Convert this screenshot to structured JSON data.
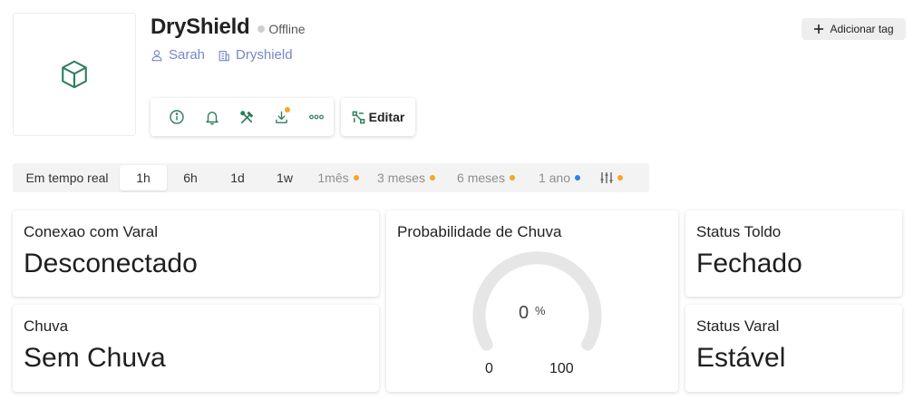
{
  "device": {
    "name": "DryShield",
    "status": "Offline",
    "owner": "Sarah",
    "group": "Dryshield"
  },
  "actions": {
    "edit_label": "Editar",
    "add_tag_label": "Adicionar tag"
  },
  "toolbar": {
    "icons": [
      "info-icon",
      "bell-icon",
      "tools-icon",
      "download-icon",
      "more-icon"
    ]
  },
  "timeframe": {
    "items": [
      {
        "label": "Em tempo real"
      },
      {
        "label": "1h",
        "active": true
      },
      {
        "label": "6h"
      },
      {
        "label": "1d"
      },
      {
        "label": "1w"
      },
      {
        "label": "1mês",
        "dot": "#f5a623"
      },
      {
        "label": "3 meses",
        "dot": "#f5a623"
      },
      {
        "label": "6 meses",
        "dot": "#f5a623"
      },
      {
        "label": "1 ano",
        "dot": "#2f80ed"
      }
    ],
    "filter_dot": "#f5a623"
  },
  "widgets": {
    "conexao": {
      "title": "Conexao com Varal",
      "value": "Desconectado"
    },
    "chuva": {
      "title": "Chuva",
      "value": "Sem Chuva"
    },
    "probabilidade": {
      "title": "Probabilidade de Chuva",
      "value": "0",
      "unit": "%",
      "min": "0",
      "max": "100",
      "level": 0
    },
    "toldo": {
      "title": "Status Toldo",
      "value": "Fechado"
    },
    "varal": {
      "title": "Status Varal",
      "value": "Estável"
    }
  },
  "colors": {
    "accent": "#2e7d5b",
    "link": "#7687c8",
    "gauge_track": "#e6e6e6"
  }
}
